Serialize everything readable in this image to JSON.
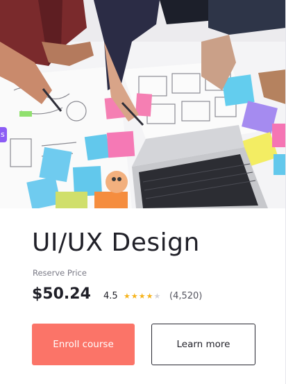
{
  "course": {
    "title": "UI/UX Design",
    "reserve_label": "Reserve Price",
    "price": "$50.24",
    "rating": 4.5,
    "rating_text": "4.5",
    "rating_count": "(4,520)",
    "stars_filled": 4,
    "stars_total": 5
  },
  "buttons": {
    "enroll_label": "Enroll course",
    "learn_label": "Learn more"
  },
  "colors": {
    "enroll_bg": "#fb7468",
    "star": "#f6b31b",
    "side_tag": "#8c5cf5"
  },
  "image": {
    "icon": "team-designing-wireframes-photo",
    "side_tag_text": "s"
  }
}
